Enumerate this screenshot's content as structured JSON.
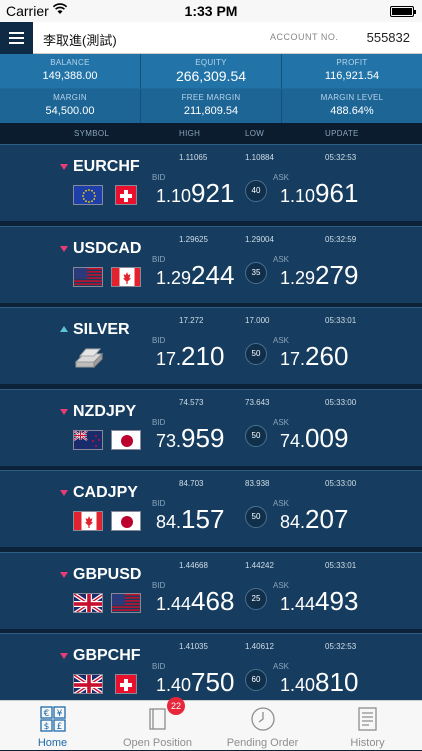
{
  "status_bar": {
    "carrier": "Carrier",
    "time": "1:33 PM"
  },
  "header": {
    "user_name": "李取進(測試)",
    "account_label": "ACCOUNT NO.",
    "account_no": "555832"
  },
  "summary": {
    "balance_label": "BALANCE",
    "balance": "149,388.00",
    "equity_label": "EQUITY",
    "equity": "266,309.54",
    "profit_label": "PROFIT",
    "profit": "116,921.54",
    "margin_label": "MARGIN",
    "margin": "54,500.00",
    "free_margin_label": "FREE MARGIN",
    "free_margin": "211,809.54",
    "margin_level_label": "MARGIN LEVEL",
    "margin_level": "488.64%"
  },
  "columns": {
    "symbol": "SYMBOL",
    "high": "HIGH",
    "low": "LOW",
    "update": "UPDATE"
  },
  "quotes": [
    {
      "symbol": "EURCHF",
      "direction": "down",
      "high": "1.11065",
      "low": "1.10884",
      "update": "05:32:53",
      "bid_label": "BID",
      "bid_prefix": "1.10",
      "bid_main": "921",
      "spread": "40",
      "ask_label": "ASK",
      "ask_prefix": "1.10",
      "ask_main": "961",
      "flag1": "eu-flag-icon",
      "flag2": "ch-flag-icon"
    },
    {
      "symbol": "USDCAD",
      "direction": "down",
      "high": "1.29625",
      "low": "1.29004",
      "update": "05:32:59",
      "bid_label": "BID",
      "bid_prefix": "1.29",
      "bid_main": "244",
      "spread": "35",
      "ask_label": "ASK",
      "ask_prefix": "1.29",
      "ask_main": "279",
      "flag1": "us-flag-icon",
      "flag2": "ca-flag-icon"
    },
    {
      "symbol": "SILVER",
      "direction": "up",
      "high": "17.272",
      "low": "17.000",
      "update": "05:33:01",
      "bid_label": "BID",
      "bid_prefix": "17.",
      "bid_main": "210",
      "spread": "50",
      "ask_label": "ASK",
      "ask_prefix": "17.",
      "ask_main": "260",
      "flag1": "silver-bars-icon",
      "flag2": ""
    },
    {
      "symbol": "NZDJPY",
      "direction": "down",
      "high": "74.573",
      "low": "73.643",
      "update": "05:33:00",
      "bid_label": "BID",
      "bid_prefix": "73.",
      "bid_main": "959",
      "spread": "50",
      "ask_label": "ASK",
      "ask_prefix": "74.",
      "ask_main": "009",
      "flag1": "nz-flag-icon",
      "flag2": "jp-flag-icon"
    },
    {
      "symbol": "CADJPY",
      "direction": "down",
      "high": "84.703",
      "low": "83.938",
      "update": "05:33:00",
      "bid_label": "BID",
      "bid_prefix": "84.",
      "bid_main": "157",
      "spread": "50",
      "ask_label": "ASK",
      "ask_prefix": "84.",
      "ask_main": "207",
      "flag1": "ca-flag-icon",
      "flag2": "jp-flag-icon"
    },
    {
      "symbol": "GBPUSD",
      "direction": "down",
      "high": "1.44668",
      "low": "1.44242",
      "update": "05:33:01",
      "bid_label": "BID",
      "bid_prefix": "1.44",
      "bid_main": "468",
      "spread": "25",
      "ask_label": "ASK",
      "ask_prefix": "1.44",
      "ask_main": "493",
      "flag1": "gb-flag-icon",
      "flag2": "us-flag-icon"
    },
    {
      "symbol": "GBPCHF",
      "direction": "down",
      "high": "1.41035",
      "low": "1.40612",
      "update": "05:32:53",
      "bid_label": "BID",
      "bid_prefix": "1.40",
      "bid_main": "750",
      "spread": "60",
      "ask_label": "ASK",
      "ask_prefix": "1.40",
      "ask_main": "810",
      "flag1": "gb-flag-icon",
      "flag2": "ch-flag-icon"
    }
  ],
  "tabs": {
    "home": "Home",
    "open_position": "Open Position",
    "open_position_badge": "22",
    "pending_order": "Pending Order",
    "history": "History"
  },
  "colors": {
    "accent": "#1d6aa9",
    "down": "#e83d78",
    "up": "#5fc4d6"
  }
}
